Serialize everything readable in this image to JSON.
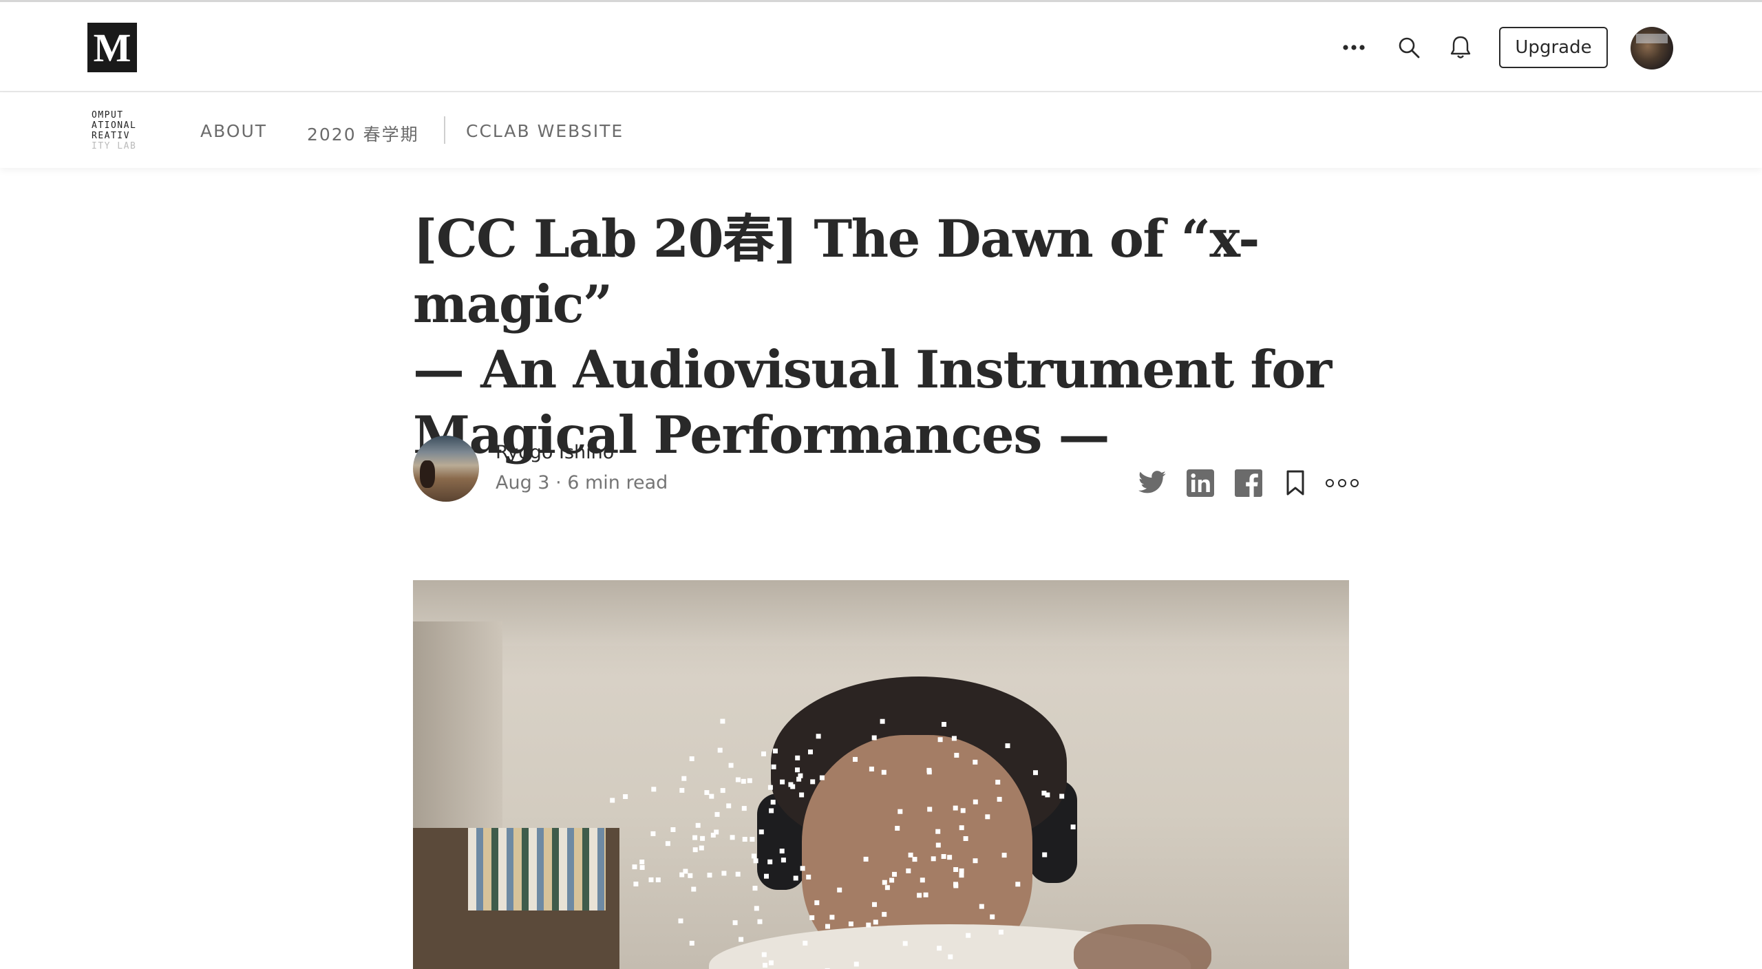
{
  "topbar": {
    "logo_letter": "M",
    "upgrade_label": "Upgrade"
  },
  "publication": {
    "logo_lines": [
      "OMPUT",
      "ATIONAL",
      "REATIV",
      "ITY LAB"
    ],
    "nav": {
      "about": "ABOUT",
      "term": "2020 春学期",
      "website": "CCLAB WEBSITE"
    }
  },
  "article": {
    "title_line1": "[CC Lab 20春] The Dawn of “x-magic”",
    "title_line2": "— An Audiovisual Instrument for",
    "title_line3": "Magical Performances —",
    "author": "Ryogo Ishino",
    "meta": "Aug 3 · 6 min read"
  },
  "icons": {
    "more": "more-horizontal-icon",
    "search": "search-icon",
    "notifications": "bell-icon",
    "twitter": "twitter-icon",
    "linkedin": "linkedin-icon",
    "facebook": "facebook-icon",
    "bookmark": "bookmark-icon",
    "article_more": "more-circles-icon"
  },
  "colors": {
    "text": "#292929",
    "muted": "#757575",
    "nav": "#6b6b6b"
  }
}
